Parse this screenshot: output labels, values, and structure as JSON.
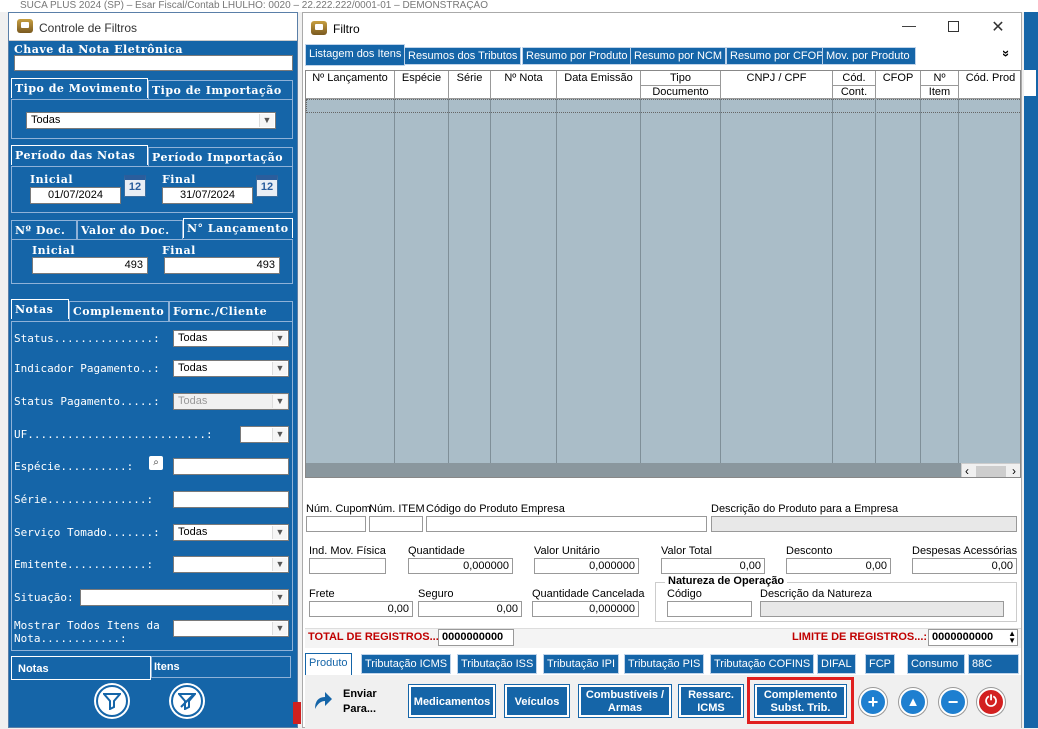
{
  "background_app": {
    "title": "SUCA PLUS 2024 (SP) – Esar Fiscal/Contab LHULHO: 0020 – 22.222.222/0001-01 – DEMONSTRAÇÃO"
  },
  "left_window": {
    "title": "Controle de Filtros",
    "chave_label": "Chave da Nota Eletrônica",
    "chave_value": "",
    "tabs_movimento": [
      "Tipo de Movimento",
      "Tipo de Importação"
    ],
    "tipo_movimento_value": "Todas",
    "tabs_periodo": [
      "Período das Notas",
      "Período Importação"
    ],
    "periodo_inicial_label": "Inicial",
    "periodo_inicial": "01/07/2024",
    "periodo_final_label": "Final",
    "periodo_final": "31/07/2024",
    "calendar_glyph": "12",
    "tabs_doc": [
      "Nº Doc.",
      "Valor do Doc.",
      "N° Lançamento"
    ],
    "lanc_inicial_label": "Inicial",
    "lanc_inicial": "493",
    "lanc_final_label": "Final",
    "lanc_final": "493",
    "tabs_notas": [
      "Notas",
      "Complemento",
      "Fornc./Cliente"
    ],
    "fields": {
      "status_label": "Status...............:",
      "status_value": "Todas",
      "indicador_label": "Indicador Pagamento..:",
      "indicador_value": "Todas",
      "status_pag_label": "Status Pagamento.....:",
      "status_pag_value": "Todas",
      "uf_label": "UF...........................:",
      "uf_value": "",
      "especie_label": "Espécie..........:",
      "especie_value": "",
      "serie_label": "Série...............:",
      "serie_value": "",
      "servico_label": "Serviço Tomado.......:",
      "servico_value": "Todas",
      "emitente_label": "Emitente............:",
      "emitente_value": "",
      "situacao_label": "Situação:",
      "situacao_value": "",
      "mostrar_label_1": "Mostrar Todos Itens da",
      "mostrar_label_2": "Nota............:",
      "mostrar_value": ""
    },
    "bottom_tabs": [
      "Notas",
      "Itens"
    ]
  },
  "right_window": {
    "title": "Filtro",
    "tabs": [
      "Listagem dos Itens",
      "Resumos dos Tributos",
      "Resumo por Produto",
      "Resumo por NCM",
      "Resumo por CFOP",
      "Mov. por Produto"
    ],
    "more_glyph": "»",
    "columns": [
      {
        "l1": "Nº Lançamento",
        "l2": ""
      },
      {
        "l1": "Espécie",
        "l2": ""
      },
      {
        "l1": "Série",
        "l2": ""
      },
      {
        "l1": "Nº Nota",
        "l2": ""
      },
      {
        "l1": "Data Emissão",
        "l2": ""
      },
      {
        "l1": "Tipo",
        "l2": "Documento"
      },
      {
        "l1": "CNPJ / CPF",
        "l2": ""
      },
      {
        "l1": "Cód.",
        "l2": "Cont."
      },
      {
        "l1": "CFOP",
        "l2": ""
      },
      {
        "l1": "Nº",
        "l2": "Item"
      },
      {
        "l1": "Cód. Prod",
        "l2": ""
      }
    ],
    "form": {
      "num_cupom_label": "Núm. Cupom",
      "num_item_label": "Núm. ITEM",
      "cod_produto_label": "Código do Produto Empresa",
      "descricao_label": "Descrição do Produto para a Empresa",
      "ind_mov_label": "Ind. Mov. Física",
      "quantidade_label": "Quantidade",
      "quantidade": "0,000000",
      "valor_unit_label": "Valor Unitário",
      "valor_unit": "0,000000",
      "valor_total_label": "Valor Total",
      "valor_total": "0,00",
      "desconto_label": "Desconto",
      "desconto": "0,00",
      "despesas_label": "Despesas Acessórias",
      "despesas": "0,00",
      "frete_label": "Frete",
      "frete": "0,00",
      "seguro_label": "Seguro",
      "seguro": "0,00",
      "qtd_cancelada_label": "Quantidade Cancelada",
      "qtd_cancelada": "0,000000",
      "natureza_title": "Natureza de Operação",
      "natureza_codigo_label": "Código",
      "natureza_desc_label": "Descrição da Natureza"
    },
    "total_label": "TOTAL DE REGISTROS...:",
    "total_value": "0000000000",
    "limite_label": "LIMITE DE REGISTROS...:",
    "limite_value": "0000000000",
    "bottom_tabs": [
      "Produto",
      "Tributação ICMS",
      "Tributação ISS",
      "Tributação IPI",
      "Tributação PIS",
      "Tributação COFINS",
      "DIFAL",
      "FCP",
      "Consumo",
      "88C"
    ],
    "enviar_label_1": "Enviar",
    "enviar_label_2": "Para...",
    "buttons": {
      "medicamentos": "Medicamentos",
      "veiculos": "Veículos",
      "combustiveis_1": "Combustíveis /",
      "combustiveis_2": "Armas",
      "ressarc_1": "Ressarc.",
      "ressarc_2": "ICMS",
      "complemento_1": "Complemento",
      "complemento_2": "Subst. Trib."
    },
    "circle_glyphs": {
      "add": "+",
      "up": "▲",
      "remove": "−",
      "power": "⏻"
    }
  },
  "colors": {
    "panel_blue": "#1565a8",
    "grid_bg": "#aabdc8",
    "total_red": "#c00000",
    "highlight": "#e02020",
    "power_red": "#d32020"
  }
}
